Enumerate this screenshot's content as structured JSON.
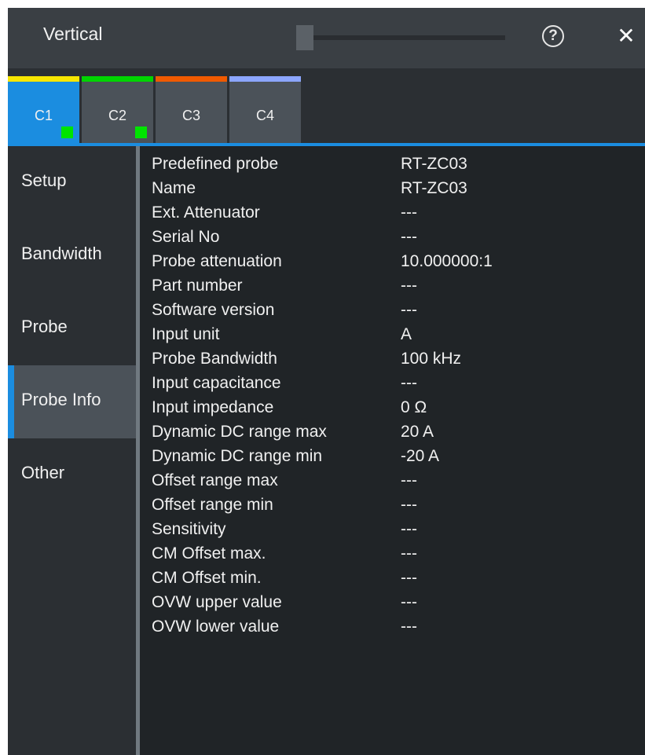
{
  "window": {
    "title": "Vertical"
  },
  "icons": {
    "help": "?",
    "close": "✕"
  },
  "tabs": [
    {
      "label": "C1",
      "color": "#f7e600",
      "active": true,
      "indicator": true
    },
    {
      "label": "C2",
      "color": "#00d400",
      "active": false,
      "indicator": true
    },
    {
      "label": "C3",
      "color": "#f05a00",
      "active": false,
      "indicator": false
    },
    {
      "label": "C4",
      "color": "#8ca6ff",
      "active": false,
      "indicator": false
    }
  ],
  "sidebar": {
    "items": [
      {
        "label": "Setup"
      },
      {
        "label": "Bandwidth"
      },
      {
        "label": "Probe"
      },
      {
        "label": "Probe Info"
      },
      {
        "label": "Other"
      }
    ],
    "active_index": 3
  },
  "probe_info": [
    {
      "key": "Predefined probe",
      "value": "RT-ZC03"
    },
    {
      "key": "Name",
      "value": "RT-ZC03"
    },
    {
      "key": "Ext. Attenuator",
      "value": "---"
    },
    {
      "key": "Serial No",
      "value": "---"
    },
    {
      "key": "Probe attenuation",
      "value": "10.000000:1"
    },
    {
      "key": "Part number",
      "value": "---"
    },
    {
      "key": "Software version",
      "value": "---"
    },
    {
      "key": "Input unit",
      "value": "A"
    },
    {
      "key": "Probe Bandwidth",
      "value": "100 kHz"
    },
    {
      "key": "Input capacitance",
      "value": "---"
    },
    {
      "key": "Input impedance",
      "value": "0 Ω"
    },
    {
      "key": "Dynamic DC range max",
      "value": "20 A"
    },
    {
      "key": "Dynamic DC range min",
      "value": "-20 A"
    },
    {
      "key": "Offset range max",
      "value": "---"
    },
    {
      "key": "Offset range min",
      "value": "---"
    },
    {
      "key": "Sensitivity",
      "value": "---"
    },
    {
      "key": "CM Offset max.",
      "value": "---"
    },
    {
      "key": "CM Offset min.",
      "value": "---"
    },
    {
      "key": "OVW upper value",
      "value": "---"
    },
    {
      "key": "OVW lower value",
      "value": "---"
    }
  ]
}
